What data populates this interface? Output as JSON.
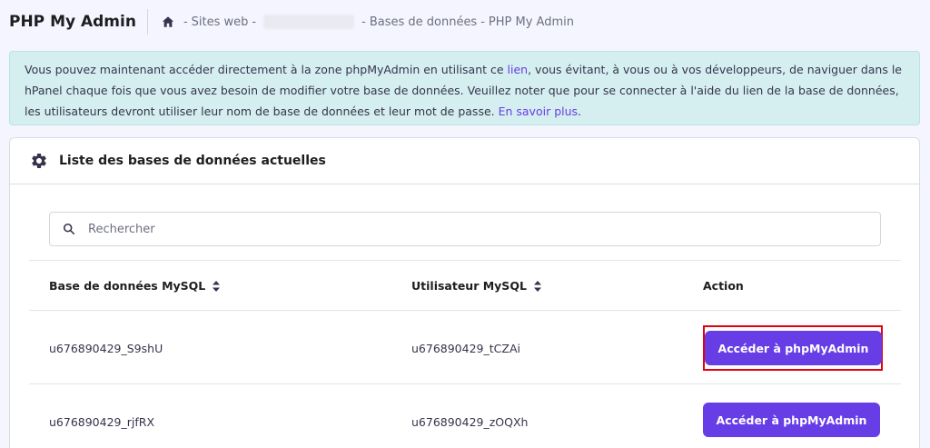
{
  "header": {
    "title": "PHP My Admin",
    "breadcrumb": {
      "sites": "Sites web",
      "hidden_site": "",
      "databases": "Bases de données",
      "current": "PHP My Admin",
      "separator": "-"
    }
  },
  "banner": {
    "text_before_link": "Vous pouvez maintenant accéder directement à la zone phpMyAdmin en utilisant ce ",
    "link_label": "lien",
    "text_after_link": ", vous évitant, à vous ou à vos développeurs, de naviguer dans le hPanel chaque fois que vous avez besoin de modifier votre base de données. Veuillez noter que pour se connecter à l'aide du lien de la base de données, les utilisateurs devront utiliser leur nom de base de données et leur mot de passe. ",
    "learn_more_label": "En savoir plus",
    "trailing": "."
  },
  "card": {
    "title": "Liste des bases de données actuelles",
    "search": {
      "placeholder": "Rechercher",
      "value": ""
    },
    "columns": {
      "database": "Base de données MySQL",
      "user": "Utilisateur MySQL",
      "action": "Action"
    },
    "rows": [
      {
        "database": "u676890429_S9shU",
        "user": "u676890429_tCZAi",
        "action_label": "Accéder à phpMyAdmin"
      },
      {
        "database": "u676890429_rjfRX",
        "user": "u676890429_zOQXh",
        "action_label": "Accéder à phpMyAdmin"
      }
    ]
  },
  "colors": {
    "accent": "#673de6",
    "banner_bg": "#d5eff0",
    "highlight": "#e3000f"
  }
}
